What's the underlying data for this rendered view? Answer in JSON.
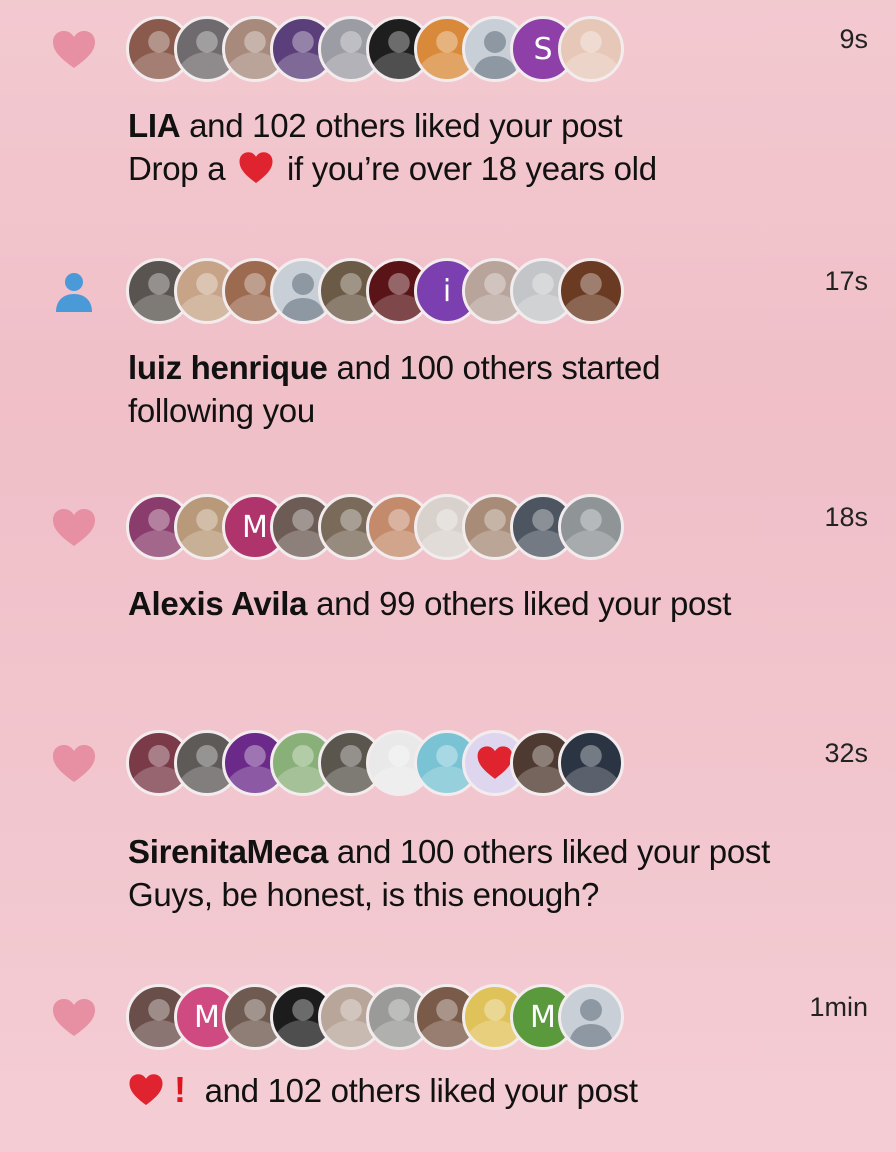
{
  "colors": {
    "heart_icon": "#e78fa3",
    "follow_icon": "#4a9ad8",
    "emoji_heart": "#e0242f"
  },
  "notifications": [
    {
      "type_icon": "heart-icon",
      "time": "9s",
      "actor": "LIA",
      "action": " and 102 others liked your post",
      "preview_a": "Drop a ",
      "preview_b": " if you’re over 18 years old",
      "avatars": [
        {
          "kind": "photo",
          "color": "#8a5a4c"
        },
        {
          "kind": "photo",
          "color": "#6f6a6d"
        },
        {
          "kind": "photo",
          "color": "#a78a7c"
        },
        {
          "kind": "photo",
          "color": "#5b3f7a"
        },
        {
          "kind": "photo",
          "color": "#9c9ca4"
        },
        {
          "kind": "photo",
          "color": "#1e1e1e"
        },
        {
          "kind": "photo",
          "color": "#d88a3a"
        },
        {
          "kind": "default",
          "color": "#c9cfd6"
        },
        {
          "kind": "letter",
          "letter": "S",
          "color": "#8e3fa8"
        },
        {
          "kind": "photo",
          "color": "#e7c8b8"
        }
      ]
    },
    {
      "type_icon": "person-icon",
      "time": "17s",
      "actor": "luiz henrique",
      "action": " and 100 others started following you",
      "avatars": [
        {
          "kind": "photo",
          "color": "#5a5450"
        },
        {
          "kind": "photo",
          "color": "#c7a488"
        },
        {
          "kind": "photo",
          "color": "#9b6a4f"
        },
        {
          "kind": "default",
          "color": "#c9cfd6"
        },
        {
          "kind": "photo",
          "color": "#6b5a45"
        },
        {
          "kind": "photo",
          "color": "#5a1418"
        },
        {
          "kind": "letter",
          "letter": "i",
          "color": "#7b3fb0"
        },
        {
          "kind": "photo",
          "color": "#b9a49c"
        },
        {
          "kind": "photo",
          "color": "#c3c5c8"
        },
        {
          "kind": "photo",
          "color": "#6a3a22"
        }
      ]
    },
    {
      "type_icon": "heart-icon",
      "time": "18s",
      "actor": "Alexis Avila",
      "action": " and 99 others liked your post",
      "avatars": [
        {
          "kind": "photo",
          "color": "#8a3c6c"
        },
        {
          "kind": "photo",
          "color": "#b89a7a"
        },
        {
          "kind": "letter",
          "letter": "M",
          "color": "#b0346c"
        },
        {
          "kind": "photo",
          "color": "#6d5c55"
        },
        {
          "kind": "photo",
          "color": "#7a6a5a"
        },
        {
          "kind": "photo",
          "color": "#c48a6c"
        },
        {
          "kind": "photo",
          "color": "#d9d2cc"
        },
        {
          "kind": "photo",
          "color": "#a88c78"
        },
        {
          "kind": "photo",
          "color": "#4d5560"
        },
        {
          "kind": "photo",
          "color": "#8f9497"
        }
      ]
    },
    {
      "type_icon": "heart-icon",
      "time": "32s",
      "actor": "SirenitaMeca",
      "action": " and 100 others liked your post",
      "preview_a": "Guys, be honest, is this enough?",
      "avatars": [
        {
          "kind": "photo",
          "color": "#7a3a48"
        },
        {
          "kind": "photo",
          "color": "#5e5a58"
        },
        {
          "kind": "photo",
          "color": "#6b2a8a"
        },
        {
          "kind": "photo",
          "color": "#8ab07a"
        },
        {
          "kind": "photo",
          "color": "#5a564e"
        },
        {
          "kind": "photo",
          "color": "#e9e9e9"
        },
        {
          "kind": "photo",
          "color": "#7ac3d4"
        },
        {
          "kind": "heart",
          "color": "#ded6ef"
        },
        {
          "kind": "photo",
          "color": "#4e3a30"
        },
        {
          "kind": "photo",
          "color": "#2a3442"
        }
      ]
    },
    {
      "type_icon": "heart-icon",
      "time": "1min",
      "actor": "",
      "action": " and 102 others liked your post",
      "excl": "!",
      "avatars": [
        {
          "kind": "photo",
          "color": "#6a4e4a"
        },
        {
          "kind": "letter",
          "letter": "M",
          "color": "#d04a82"
        },
        {
          "kind": "photo",
          "color": "#6e5a50"
        },
        {
          "kind": "photo",
          "color": "#1c1c1c"
        },
        {
          "kind": "photo",
          "color": "#b8a69a"
        },
        {
          "kind": "photo",
          "color": "#9a9a98"
        },
        {
          "kind": "photo",
          "color": "#7a5a48"
        },
        {
          "kind": "photo",
          "color": "#e0c25a"
        },
        {
          "kind": "letter",
          "letter": "M",
          "color": "#5a9a3c"
        },
        {
          "kind": "default",
          "color": "#c9cfd6"
        }
      ]
    }
  ]
}
